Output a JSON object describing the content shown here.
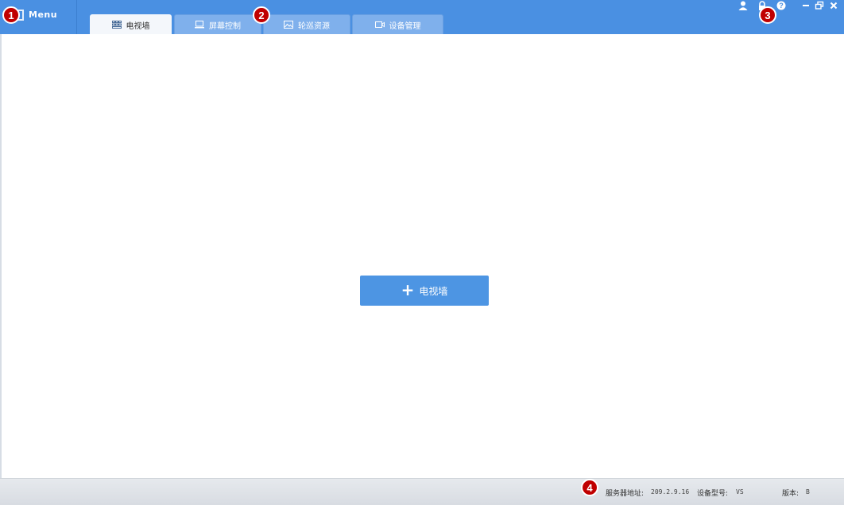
{
  "header": {
    "menu_label": "Menu",
    "tabs": [
      {
        "label": "电视墙",
        "icon": "grid-icon",
        "active": true
      },
      {
        "label": "屏幕控制",
        "icon": "monitor-icon",
        "active": false
      },
      {
        "label": "轮巡资源",
        "icon": "image-icon",
        "active": false
      },
      {
        "label": "设备管理",
        "icon": "camera-icon",
        "active": false
      }
    ],
    "toolbar_icons": [
      "user-icon",
      "lock-icon",
      "help-icon"
    ],
    "window_controls": [
      "minimize-icon",
      "restore-icon",
      "close-icon"
    ]
  },
  "main": {
    "add_button_label": "电视墙"
  },
  "status": {
    "server_label": "服务器地址:",
    "server_value": "209.2.9.16",
    "model_label": "设备型号:",
    "model_value": "VS",
    "version_label": "版本:",
    "version_value": "B"
  },
  "badges": [
    "1",
    "2",
    "3",
    "4"
  ],
  "colors": {
    "header_blue": "#4a90e2",
    "tab_inactive": "#7fb0ec",
    "button_blue": "#4d95e3",
    "badge_red": "#c00000"
  }
}
